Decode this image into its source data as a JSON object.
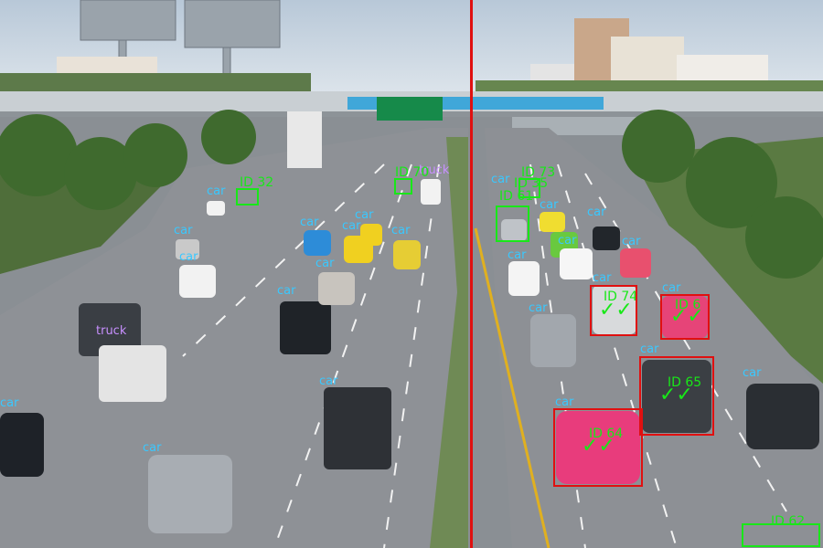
{
  "video": {
    "divider_color": "#e01010",
    "label_colors": {
      "car": "#39c8ff",
      "truck": "#c890ff",
      "id": "#18e818",
      "alert_box": "#e01010"
    }
  },
  "left_view": {
    "detections": [
      {
        "class": "car",
        "text": "car"
      },
      {
        "class": "car",
        "text": "car"
      },
      {
        "class": "car",
        "text": "car"
      },
      {
        "class": "car",
        "text": "car"
      },
      {
        "class": "car",
        "text": "car"
      },
      {
        "class": "car",
        "text": "car"
      },
      {
        "class": "car",
        "text": "car"
      },
      {
        "class": "car",
        "text": "car"
      },
      {
        "class": "car",
        "text": "car"
      },
      {
        "class": "car",
        "text": "car"
      },
      {
        "class": "car",
        "text": "car"
      },
      {
        "class": "car",
        "text": "car"
      },
      {
        "class": "truck",
        "text": "truck"
      },
      {
        "class": "truck",
        "text": "truck"
      }
    ],
    "tracked_ids": [
      {
        "text": "ID 32"
      },
      {
        "text": "ID 70"
      }
    ]
  },
  "right_view": {
    "detections": [
      {
        "class": "car",
        "text": "car"
      },
      {
        "class": "car",
        "text": "car"
      },
      {
        "class": "car",
        "text": "car"
      },
      {
        "class": "car",
        "text": "car"
      },
      {
        "class": "car",
        "text": "car"
      },
      {
        "class": "car",
        "text": "car"
      },
      {
        "class": "car",
        "text": "car"
      },
      {
        "class": "car",
        "text": "car"
      },
      {
        "class": "car",
        "text": "car"
      },
      {
        "class": "car",
        "text": "car"
      },
      {
        "class": "car",
        "text": "car"
      }
    ],
    "tracked_ids": [
      {
        "text": "ID 73"
      },
      {
        "text": "ID 35"
      },
      {
        "text": "ID 61"
      },
      {
        "text": "ID 74",
        "alert": true
      },
      {
        "text": "ID 6",
        "alert": true
      },
      {
        "text": "ID 65",
        "alert": true
      },
      {
        "text": "ID 64",
        "alert": true
      },
      {
        "text": "ID 62"
      }
    ]
  }
}
